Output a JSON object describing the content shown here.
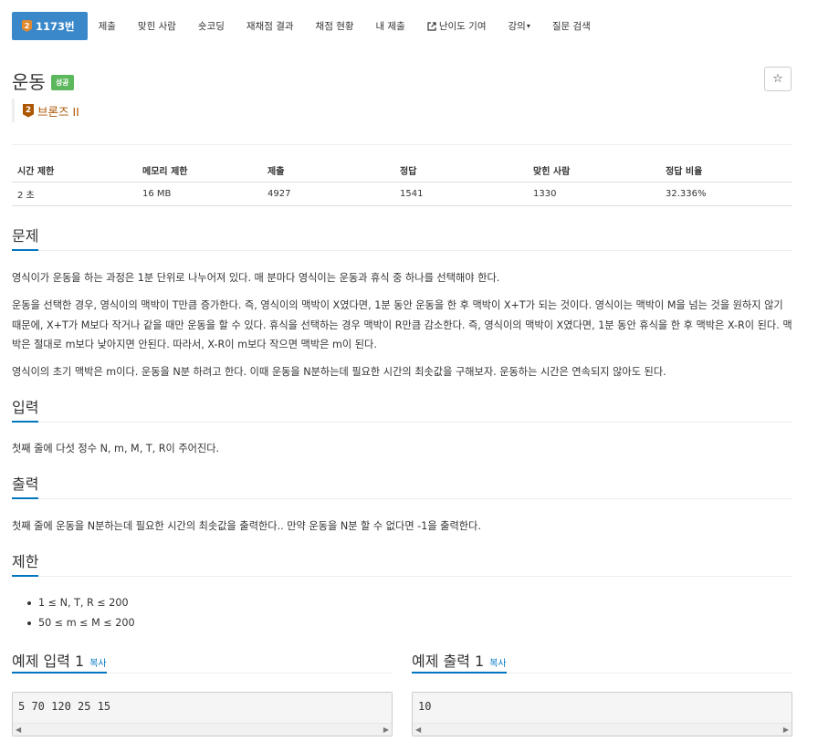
{
  "nav": {
    "active_badge": "2",
    "active_label": "1173번",
    "items": [
      "제출",
      "맞힌 사람",
      "숏코딩",
      "재채점 결과",
      "채점 현황",
      "내 제출",
      "난이도 기여",
      "강의",
      "질문 검색"
    ]
  },
  "problem": {
    "title": "운동",
    "status": "성공",
    "tier_badge": "2",
    "tier": "브론즈 II",
    "star": "☆"
  },
  "info_table": {
    "headers": [
      "시간 제한",
      "메모리 제한",
      "제출",
      "정답",
      "맞힌 사람",
      "정답 비율"
    ],
    "values": [
      "2 초",
      "16 MB",
      "4927",
      "1541",
      "1330",
      "32.336%"
    ]
  },
  "sections": {
    "problem_title": "문제",
    "problem_p1": "영식이가 운동을 하는 과정은 1분 단위로 나누어져 있다. 매 분마다 영식이는 운동과 휴식 중 하나를 선택해야 한다.",
    "problem_p2": "운동을 선택한 경우, 영식이의 맥박이 T만큼 증가한다. 즉, 영식이의 맥박이 X였다면, 1분 동안 운동을 한 후 맥박이 X+T가 되는 것이다. 영식이는 맥박이 M을 넘는 것을 원하지 않기 때문에, X+T가 M보다 작거나 같을 때만 운동을 할 수 있다. 휴식을 선택하는 경우 맥박이 R만큼 감소한다. 즉, 영식이의 맥박이 X였다면, 1분 동안 휴식을 한 후 맥박은 X-R이 된다. 맥박은 절대로 m보다 낮아지면 안된다. 따라서, X-R이 m보다 작으면 맥박은 m이 된다.",
    "problem_p3": "영식이의 초기 맥박은 m이다. 운동을 N분 하려고 한다. 이때 운동을 N분하는데 필요한 시간의 최솟값을 구해보자. 운동하는 시간은 연속되지 않아도 된다.",
    "input_title": "입력",
    "input_p": "첫째 줄에 다섯 정수 N, m, M, T, R이 주어진다.",
    "output_title": "출력",
    "output_p": "첫째 줄에 운동을 N분하는데 필요한 시간의 최솟값을 출력한다.. 만약 운동을 N분 할 수 없다면 -1을 출력한다.",
    "limit_title": "제한",
    "limits": [
      "1 ≤ N, T, R ≤ 200",
      "50 ≤ m ≤ M ≤ 200"
    ]
  },
  "samples": {
    "input_label": "예제 입력 1",
    "output_label": "예제 출력 1",
    "copy": "복사",
    "input": "5 70 120 25 15",
    "output": "10"
  }
}
